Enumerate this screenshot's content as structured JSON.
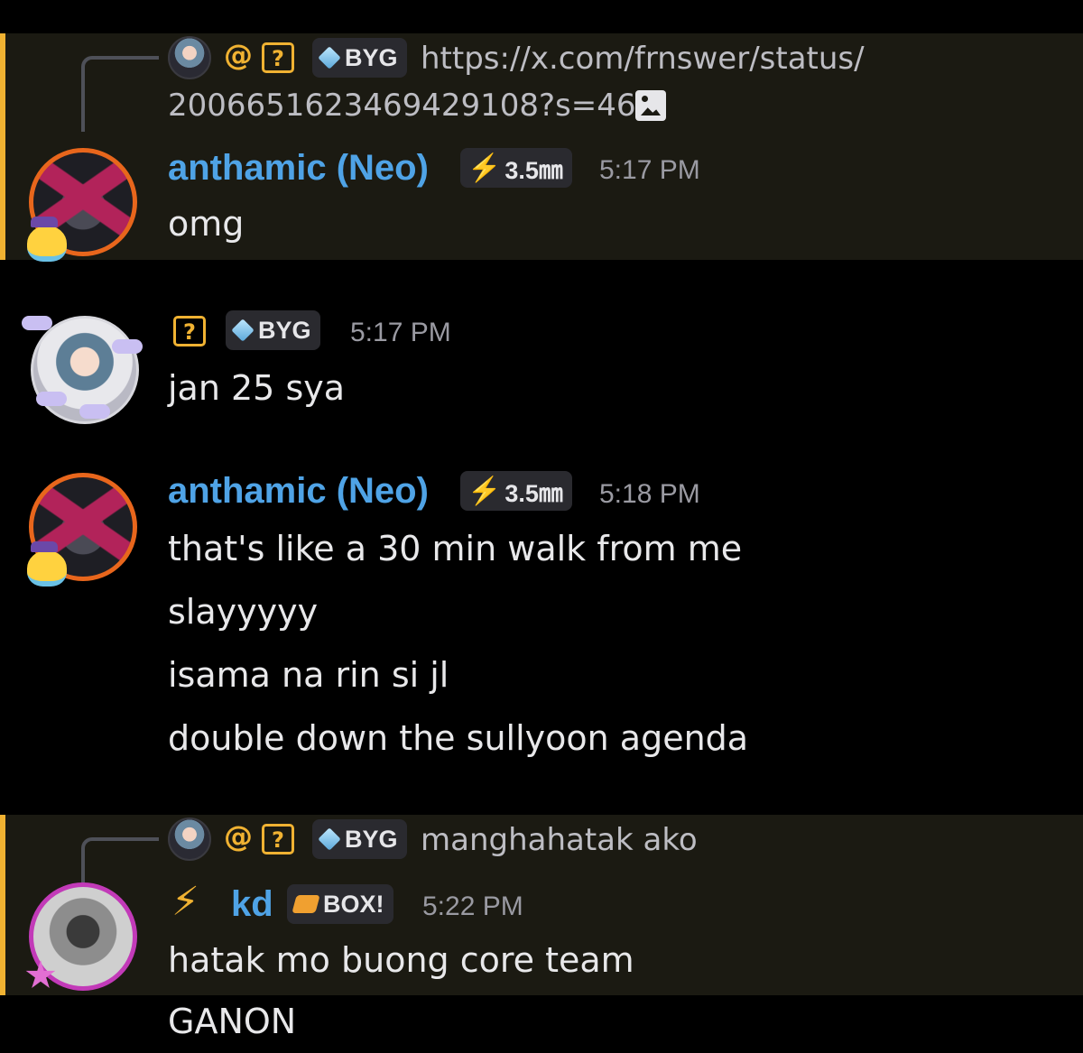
{
  "colors": {
    "highlight_bg": "#1b1a12",
    "highlight_bar": "#f0b232",
    "username": "#4fa3e6",
    "role_tag_bg": "#2a2a2f",
    "timestamp": "#9a9aa2"
  },
  "reply1": {
    "at": "@",
    "unknown": "?",
    "tag": "BYG",
    "line1": "https://x.com/frnswer/status/",
    "line2": "2006651623469429108?s=46",
    "attachment_icon": "image-icon"
  },
  "msg1": {
    "username": "anthamic (Neo)",
    "tag": "3.5㎜",
    "time": "5:17 PM",
    "lines": [
      "omg"
    ]
  },
  "msg2": {
    "username": "?",
    "tag": "BYG",
    "time": "5:17 PM",
    "lines": [
      "jan 25 sya"
    ]
  },
  "msg3": {
    "username": "anthamic (Neo)",
    "tag": "3.5㎜",
    "time": "5:18 PM",
    "lines": [
      "that's like a 30 min walk from me",
      "slayyyyy",
      "isama na rin si jl",
      "double down the sullyoon agenda"
    ]
  },
  "reply2": {
    "at": "@",
    "unknown": "?",
    "tag": "BYG",
    "text": "manghahatak ako"
  },
  "msg4": {
    "username": "kd",
    "tag": "BOX!",
    "time": "5:22 PM",
    "lines": [
      "hatak mo buong core team",
      "GANON"
    ]
  }
}
